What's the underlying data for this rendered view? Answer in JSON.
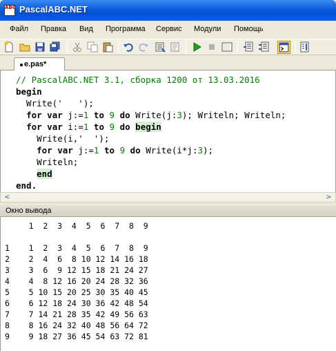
{
  "window": {
    "title": "PascalABC.NET",
    "icon_text": "ABC"
  },
  "menu": [
    "Файл",
    "Правка",
    "Вид",
    "Программа",
    "Сервис",
    "Модули",
    "Помощь"
  ],
  "toolbar_icons": [
    "new-file-icon",
    "open-folder-icon",
    "save-icon",
    "save-all-icon",
    "cut-icon",
    "copy-icon",
    "paste-icon",
    "undo-icon",
    "redo-icon",
    "compile-icon",
    "build-icon",
    "run-icon",
    "stop-icon",
    "form-designer-icon",
    "debug-step-icon",
    "debug-step-over-icon",
    "output-window-icon",
    "options-icon"
  ],
  "tab": {
    "label": "e.pas*"
  },
  "code": [
    [
      {
        "t": "// PascalABC.NET 3.1, сборка 1200 от 13.03.2016",
        "c": "comment"
      }
    ],
    [
      {
        "t": "begin",
        "c": "kw"
      }
    ],
    [
      {
        "t": "  Write('   ');",
        "c": ""
      }
    ],
    [
      {
        "t": "  ",
        "c": ""
      },
      {
        "t": "for var",
        "c": "kw"
      },
      {
        "t": " j:=",
        "c": ""
      },
      {
        "t": "1",
        "c": "num"
      },
      {
        "t": " ",
        "c": ""
      },
      {
        "t": "to",
        "c": "kw"
      },
      {
        "t": " ",
        "c": ""
      },
      {
        "t": "9",
        "c": "num"
      },
      {
        "t": " ",
        "c": ""
      },
      {
        "t": "do",
        "c": "kw"
      },
      {
        "t": " Write(j:",
        "c": ""
      },
      {
        "t": "3",
        "c": "num"
      },
      {
        "t": "); Writeln; Writeln;",
        "c": ""
      }
    ],
    [
      {
        "t": "  ",
        "c": ""
      },
      {
        "t": "for var",
        "c": "kw"
      },
      {
        "t": " i:=",
        "c": ""
      },
      {
        "t": "1",
        "c": "num"
      },
      {
        "t": " ",
        "c": ""
      },
      {
        "t": "to",
        "c": "kw"
      },
      {
        "t": " ",
        "c": ""
      },
      {
        "t": "9",
        "c": "num"
      },
      {
        "t": " ",
        "c": ""
      },
      {
        "t": "do",
        "c": "kw"
      },
      {
        "t": " ",
        "c": ""
      },
      {
        "t": "begin",
        "c": "hl"
      }
    ],
    [
      {
        "t": "    Write(i,'  ');",
        "c": ""
      }
    ],
    [
      {
        "t": "    ",
        "c": ""
      },
      {
        "t": "for var",
        "c": "kw"
      },
      {
        "t": " j:=",
        "c": ""
      },
      {
        "t": "1",
        "c": "num"
      },
      {
        "t": " ",
        "c": ""
      },
      {
        "t": "to",
        "c": "kw"
      },
      {
        "t": " ",
        "c": ""
      },
      {
        "t": "9",
        "c": "num"
      },
      {
        "t": " ",
        "c": ""
      },
      {
        "t": "do",
        "c": "kw"
      },
      {
        "t": " Write(i*j:",
        "c": ""
      },
      {
        "t": "3",
        "c": "num"
      },
      {
        "t": ");",
        "c": ""
      }
    ],
    [
      {
        "t": "    Writeln;",
        "c": ""
      }
    ],
    [
      {
        "t": "    ",
        "c": ""
      },
      {
        "t": "end",
        "c": "hl"
      }
    ],
    [
      {
        "t": "end.",
        "c": "kw"
      }
    ]
  ],
  "output": {
    "title": "Окно вывода",
    "lines": [
      "     1  2  3  4  5  6  7  8  9",
      "",
      "1    1  2  3  4  5  6  7  8  9",
      "2    2  4  6  8 10 12 14 16 18",
      "3    3  6  9 12 15 18 21 24 27",
      "4    4  8 12 16 20 24 28 32 36",
      "5    5 10 15 20 25 30 35 40 45",
      "6    6 12 18 24 30 36 42 48 54",
      "7    7 14 21 28 35 42 49 56 63",
      "8    8 16 24 32 40 48 56 64 72",
      "9    9 18 27 36 45 54 63 72 81"
    ]
  },
  "scrollbar": {
    "left_arrow": "<",
    "right_arrow": ">"
  }
}
